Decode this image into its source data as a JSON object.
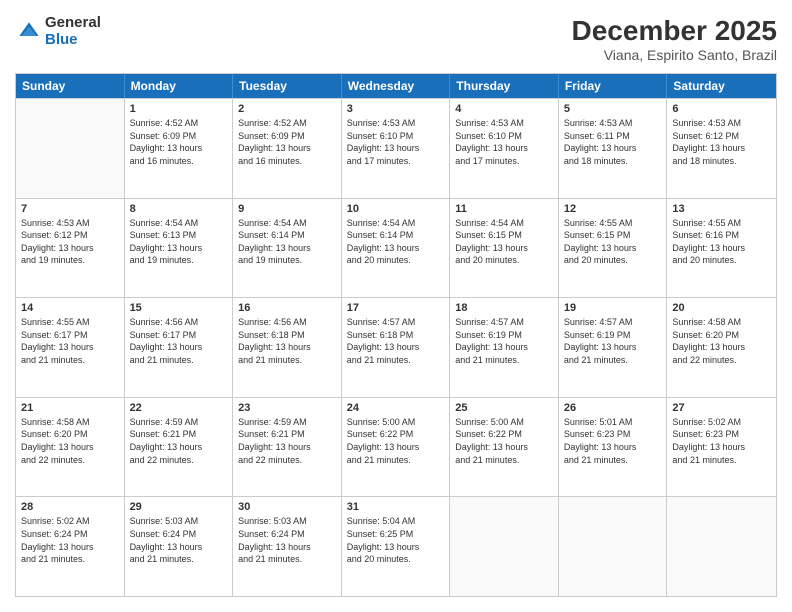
{
  "logo": {
    "part1": "General",
    "part2": "Blue"
  },
  "header": {
    "month": "December 2025",
    "location": "Viana, Espirito Santo, Brazil"
  },
  "days_of_week": [
    "Sunday",
    "Monday",
    "Tuesday",
    "Wednesday",
    "Thursday",
    "Friday",
    "Saturday"
  ],
  "weeks": [
    [
      {
        "day": "",
        "info": ""
      },
      {
        "day": "1",
        "info": "Sunrise: 4:52 AM\nSunset: 6:09 PM\nDaylight: 13 hours\nand 16 minutes."
      },
      {
        "day": "2",
        "info": "Sunrise: 4:52 AM\nSunset: 6:09 PM\nDaylight: 13 hours\nand 16 minutes."
      },
      {
        "day": "3",
        "info": "Sunrise: 4:53 AM\nSunset: 6:10 PM\nDaylight: 13 hours\nand 17 minutes."
      },
      {
        "day": "4",
        "info": "Sunrise: 4:53 AM\nSunset: 6:10 PM\nDaylight: 13 hours\nand 17 minutes."
      },
      {
        "day": "5",
        "info": "Sunrise: 4:53 AM\nSunset: 6:11 PM\nDaylight: 13 hours\nand 18 minutes."
      },
      {
        "day": "6",
        "info": "Sunrise: 4:53 AM\nSunset: 6:12 PM\nDaylight: 13 hours\nand 18 minutes."
      }
    ],
    [
      {
        "day": "7",
        "info": "Sunrise: 4:53 AM\nSunset: 6:12 PM\nDaylight: 13 hours\nand 19 minutes."
      },
      {
        "day": "8",
        "info": "Sunrise: 4:54 AM\nSunset: 6:13 PM\nDaylight: 13 hours\nand 19 minutes."
      },
      {
        "day": "9",
        "info": "Sunrise: 4:54 AM\nSunset: 6:14 PM\nDaylight: 13 hours\nand 19 minutes."
      },
      {
        "day": "10",
        "info": "Sunrise: 4:54 AM\nSunset: 6:14 PM\nDaylight: 13 hours\nand 20 minutes."
      },
      {
        "day": "11",
        "info": "Sunrise: 4:54 AM\nSunset: 6:15 PM\nDaylight: 13 hours\nand 20 minutes."
      },
      {
        "day": "12",
        "info": "Sunrise: 4:55 AM\nSunset: 6:15 PM\nDaylight: 13 hours\nand 20 minutes."
      },
      {
        "day": "13",
        "info": "Sunrise: 4:55 AM\nSunset: 6:16 PM\nDaylight: 13 hours\nand 20 minutes."
      }
    ],
    [
      {
        "day": "14",
        "info": "Sunrise: 4:55 AM\nSunset: 6:17 PM\nDaylight: 13 hours\nand 21 minutes."
      },
      {
        "day": "15",
        "info": "Sunrise: 4:56 AM\nSunset: 6:17 PM\nDaylight: 13 hours\nand 21 minutes."
      },
      {
        "day": "16",
        "info": "Sunrise: 4:56 AM\nSunset: 6:18 PM\nDaylight: 13 hours\nand 21 minutes."
      },
      {
        "day": "17",
        "info": "Sunrise: 4:57 AM\nSunset: 6:18 PM\nDaylight: 13 hours\nand 21 minutes."
      },
      {
        "day": "18",
        "info": "Sunrise: 4:57 AM\nSunset: 6:19 PM\nDaylight: 13 hours\nand 21 minutes."
      },
      {
        "day": "19",
        "info": "Sunrise: 4:57 AM\nSunset: 6:19 PM\nDaylight: 13 hours\nand 21 minutes."
      },
      {
        "day": "20",
        "info": "Sunrise: 4:58 AM\nSunset: 6:20 PM\nDaylight: 13 hours\nand 22 minutes."
      }
    ],
    [
      {
        "day": "21",
        "info": "Sunrise: 4:58 AM\nSunset: 6:20 PM\nDaylight: 13 hours\nand 22 minutes."
      },
      {
        "day": "22",
        "info": "Sunrise: 4:59 AM\nSunset: 6:21 PM\nDaylight: 13 hours\nand 22 minutes."
      },
      {
        "day": "23",
        "info": "Sunrise: 4:59 AM\nSunset: 6:21 PM\nDaylight: 13 hours\nand 22 minutes."
      },
      {
        "day": "24",
        "info": "Sunrise: 5:00 AM\nSunset: 6:22 PM\nDaylight: 13 hours\nand 21 minutes."
      },
      {
        "day": "25",
        "info": "Sunrise: 5:00 AM\nSunset: 6:22 PM\nDaylight: 13 hours\nand 21 minutes."
      },
      {
        "day": "26",
        "info": "Sunrise: 5:01 AM\nSunset: 6:23 PM\nDaylight: 13 hours\nand 21 minutes."
      },
      {
        "day": "27",
        "info": "Sunrise: 5:02 AM\nSunset: 6:23 PM\nDaylight: 13 hours\nand 21 minutes."
      }
    ],
    [
      {
        "day": "28",
        "info": "Sunrise: 5:02 AM\nSunset: 6:24 PM\nDaylight: 13 hours\nand 21 minutes."
      },
      {
        "day": "29",
        "info": "Sunrise: 5:03 AM\nSunset: 6:24 PM\nDaylight: 13 hours\nand 21 minutes."
      },
      {
        "day": "30",
        "info": "Sunrise: 5:03 AM\nSunset: 6:24 PM\nDaylight: 13 hours\nand 21 minutes."
      },
      {
        "day": "31",
        "info": "Sunrise: 5:04 AM\nSunset: 6:25 PM\nDaylight: 13 hours\nand 20 minutes."
      },
      {
        "day": "",
        "info": ""
      },
      {
        "day": "",
        "info": ""
      },
      {
        "day": "",
        "info": ""
      }
    ]
  ]
}
